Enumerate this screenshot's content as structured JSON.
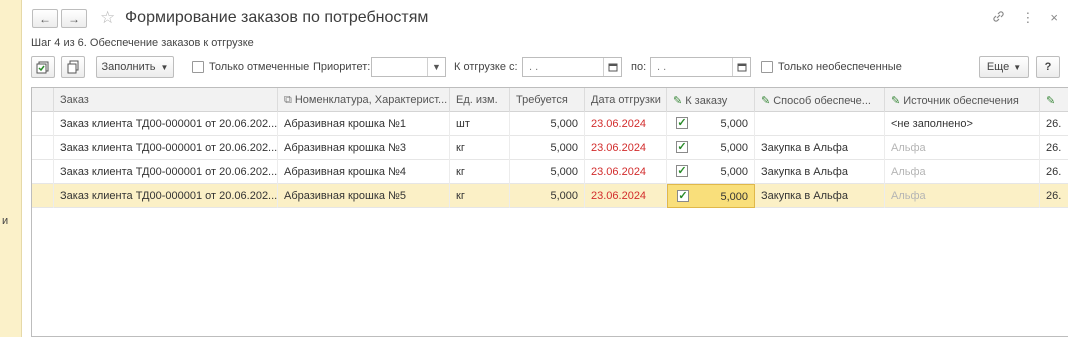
{
  "left_strip": {
    "fragment": "и"
  },
  "title": "Формирование заказов по потребностям",
  "nav": {
    "back": "←",
    "forward": "→"
  },
  "star": "☆",
  "title_icons": {
    "link": "🔗",
    "more": "⋮",
    "close": "×"
  },
  "step": "Шаг 4 из 6. Обеспечение заказов к отгрузке",
  "toolbar": {
    "fill_label": "Заполнить",
    "only_marked": "Только отмеченные",
    "priority_label": "Приоритет:",
    "priority_value": "",
    "ship_from_label": "К отгрузке с:",
    "ship_from_value": ". .",
    "ship_to_label": "по:",
    "ship_to_value": ". .",
    "only_unsecured": "Только необеспеченные",
    "more_label": "Еще",
    "help_label": "?"
  },
  "columns": [
    "Заказ",
    "Номенклатура, Характерист...",
    "Ед. изм.",
    "Требуется",
    "Дата отгрузки",
    "К заказу",
    "Способ обеспече...",
    "Источник обеспечения",
    ""
  ],
  "rows": [
    {
      "order": "Заказ клиента ТД00-000001 от 20.06.202...",
      "item": "Абразивная крошка №1",
      "unit": "шт",
      "required": "5,000",
      "ship_date": "23.06.2024",
      "checked": true,
      "to_order": "5,000",
      "method": "",
      "source": "<не заполнено>",
      "last": "26."
    },
    {
      "order": "Заказ клиента ТД00-000001 от 20.06.202...",
      "item": "Абразивная крошка №3",
      "unit": "кг",
      "required": "5,000",
      "ship_date": "23.06.2024",
      "checked": true,
      "to_order": "5,000",
      "method": "Закупка в Альфа",
      "source": "Альфа",
      "last": "26."
    },
    {
      "order": "Заказ клиента ТД00-000001 от 20.06.202...",
      "item": "Абразивная крошка №4",
      "unit": "кг",
      "required": "5,000",
      "ship_date": "23.06.2024",
      "checked": true,
      "to_order": "5,000",
      "method": "Закупка в Альфа",
      "source": "Альфа",
      "last": "26."
    },
    {
      "order": "Заказ клиента ТД00-000001 от 20.06.202...",
      "item": "Абразивная крошка №5",
      "unit": "кг",
      "required": "5,000",
      "ship_date": "23.06.2024",
      "checked": true,
      "to_order": "5,000",
      "method": "Закупка в Альфа",
      "source": "Альфа",
      "last": "26."
    }
  ],
  "selected_row": 3,
  "colors": {
    "selected_row": "#fbf0c6",
    "focus_cell": "#f9df7b",
    "date_red": "#d22c2c",
    "left_strip": "#fbf1c9"
  }
}
